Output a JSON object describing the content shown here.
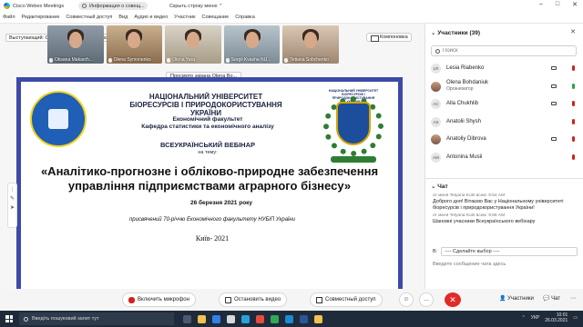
{
  "titlebar": {
    "app_title": "Cisco Webex Meetings",
    "status_pill": "Информация о совещ...",
    "hide_bar": "Скрыть строку меню"
  },
  "menu": [
    "Файл",
    "Редактирование",
    "Совместный доступ",
    "Вид",
    "Аудио и видео",
    "Участник",
    "Совещание",
    "Справка"
  ],
  "stage": {
    "speaker": "Выступающий: Olena Bohdaniuk (организатор)",
    "layout_button": "Компоновка",
    "sharing_label": "Просмотр экрана Olena Bo...",
    "thumbnails": [
      "Oksana Makarch...",
      "Olena Symonenko",
      "Olena Yara",
      "Sergii Kvasha NU...",
      "Tetiana Sobchenko"
    ]
  },
  "slide": {
    "university": "НАЦІОНАЛЬНИЙ УНІВЕРСИТЕТ БІОРЕСУРСІВ І ПРИРОДОКОРИСТУВАННЯ УКРАЇНИ",
    "faculty": "Економічний факультет",
    "department": "Кафедра статистики та економічного аналізу",
    "webinar": "ВСЕУКРАЇНСЬКИЙ ВЕБІНАР",
    "topic_label": "на тему:",
    "topic": "«Аналітико-прогнозне і обліково-природне забезпечення управління підприємствами аграрного бізнесу»",
    "date": "26 березня 2021 року",
    "dedication": "присвячений 70-річчю Економічного факультету НУБіП України",
    "city": "Київ- 2021",
    "emblem_caption": "НАЦІОНАЛЬНИЙ УНІВЕРСИТЕТ БІОРЕСУРСІВ І ПРИРОДОКОРИСТУВАННЯ УКРАЇНИ"
  },
  "controls": {
    "mic": "Включить микрофон",
    "video": "Остановить видео",
    "share": "Совместный доступ",
    "participants": "Участники",
    "chat": "Чат",
    "more": "...",
    "end": "✕"
  },
  "participants_panel": {
    "title": "Участники (39)",
    "search_placeholder": "Поиск",
    "list": [
      {
        "initials": "LR",
        "name": "Lesia Riabenko",
        "role": "",
        "mic": "muted"
      },
      {
        "initials": "",
        "name": "Olena Bohdaniuk",
        "role": "Организатор",
        "mic": "active"
      },
      {
        "initials": "AC",
        "name": "Alla Chukhlib",
        "role": "",
        "mic": "muted"
      },
      {
        "initials": "AS",
        "name": "Anatolii Shysh",
        "role": "",
        "mic": "muted"
      },
      {
        "initials": "",
        "name": "Anatoliy Dibrova",
        "role": "",
        "mic": "muted"
      },
      {
        "initials": "AM",
        "name": "Antonina Musii",
        "role": "",
        "mic": "muted"
      }
    ]
  },
  "chat": {
    "title": "Чат",
    "messages": [
      {
        "meta": "от меня Tetyana Kuts всем: 9:54 AM",
        "text": "Доброго дня! Вітаємо Вас у Національному університеті біоресурсів і природокористування України!"
      },
      {
        "meta": "от меня Tetyana Kuts всем: 9:55 AM",
        "text": "Шановні учасники Всеукраїнського вебінару"
      }
    ],
    "to_label": "В:",
    "to_select": "---- Сделайте выбор ----",
    "input_placeholder": "Введите сообщение чата здесь"
  },
  "taskbar": {
    "search": "Введіть пошуковий запит тут",
    "lang": "УКР",
    "time": "10:01",
    "date": "26.03.2021"
  },
  "colors": {
    "slide_border": "#3c4aa8",
    "end_button": "#e02b27",
    "muted": "#d2211d",
    "active": "#2ea043"
  }
}
